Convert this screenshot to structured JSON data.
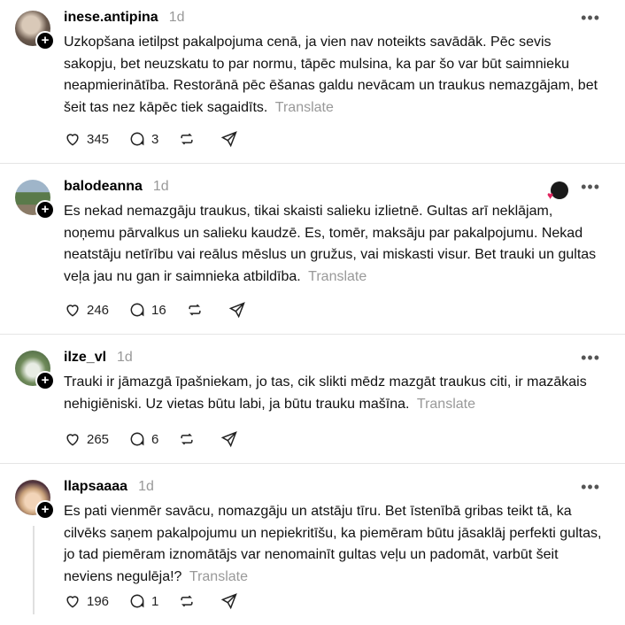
{
  "posts": [
    {
      "username": "inese.antipina",
      "time": "1d",
      "text": "Uzkopšana ietilpst pakalpojuma cenā, ja vien nav noteikts savādāk. Pēc sevis sakopju, bet neuzskatu to par normu, tāpēc mulsina, ka par šo var būt saimnieku neapmierinātība. Restorānā pēc ēšanas galdu nevācam un traukus nemazgājam, bet šeit tas nez kāpēc tiek sagaidīts.",
      "translate": "Translate",
      "likes": "345",
      "replies": "3"
    },
    {
      "username": "balodeanna",
      "time": "1d",
      "text": "Es nekad nemazgāju traukus, tikai skaisti salieku izlietnē. Gultas arī neklājam, noņemu pārvalkus un salieku kaudzē. Es, tomēr, maksāju par pakalpojumu. Nekad neatstāju netīrību vai reālus mēslus un gružus, vai miskasti visur. Bet trauki un gultas veļa jau nu gan ir saimnieka atbildība.",
      "translate": "Translate",
      "likes": "246",
      "replies": "16"
    },
    {
      "username": "ilze_vl",
      "time": "1d",
      "text": "Trauki ir jāmazgā īpašniekam, jo tas, cik slikti mēdz mazgāt traukus citi, ir mazākais nehigiēniski. Uz vietas būtu labi, ja būtu trauku mašīna.",
      "translate": "Translate",
      "likes": "265",
      "replies": "6"
    },
    {
      "username": "llapsaaaa",
      "time": "1d",
      "text": "Es pati vienmēr savācu, nomazgāju un atstāju tīru. Bet īstenībā gribas teikt tā, ka cilvēks saņem pakalpojumu un nepiekritīšu, ka piemēram būtu jāsaklāj perfekti gultas, jo tad piemēram iznomātājs var nenomainīt gultas veļu un padomāt, varbūt šeit neviens negulēja!?",
      "translate": "Translate",
      "likes": "196",
      "replies": "1"
    }
  ],
  "icons": {
    "like": "heart-icon",
    "reply": "comment-icon",
    "repost": "repost-icon",
    "share": "share-icon",
    "more": "more-icon",
    "follow": "plus-icon"
  },
  "colors": {
    "muted": "#999999",
    "like_red": "#e0245e"
  }
}
